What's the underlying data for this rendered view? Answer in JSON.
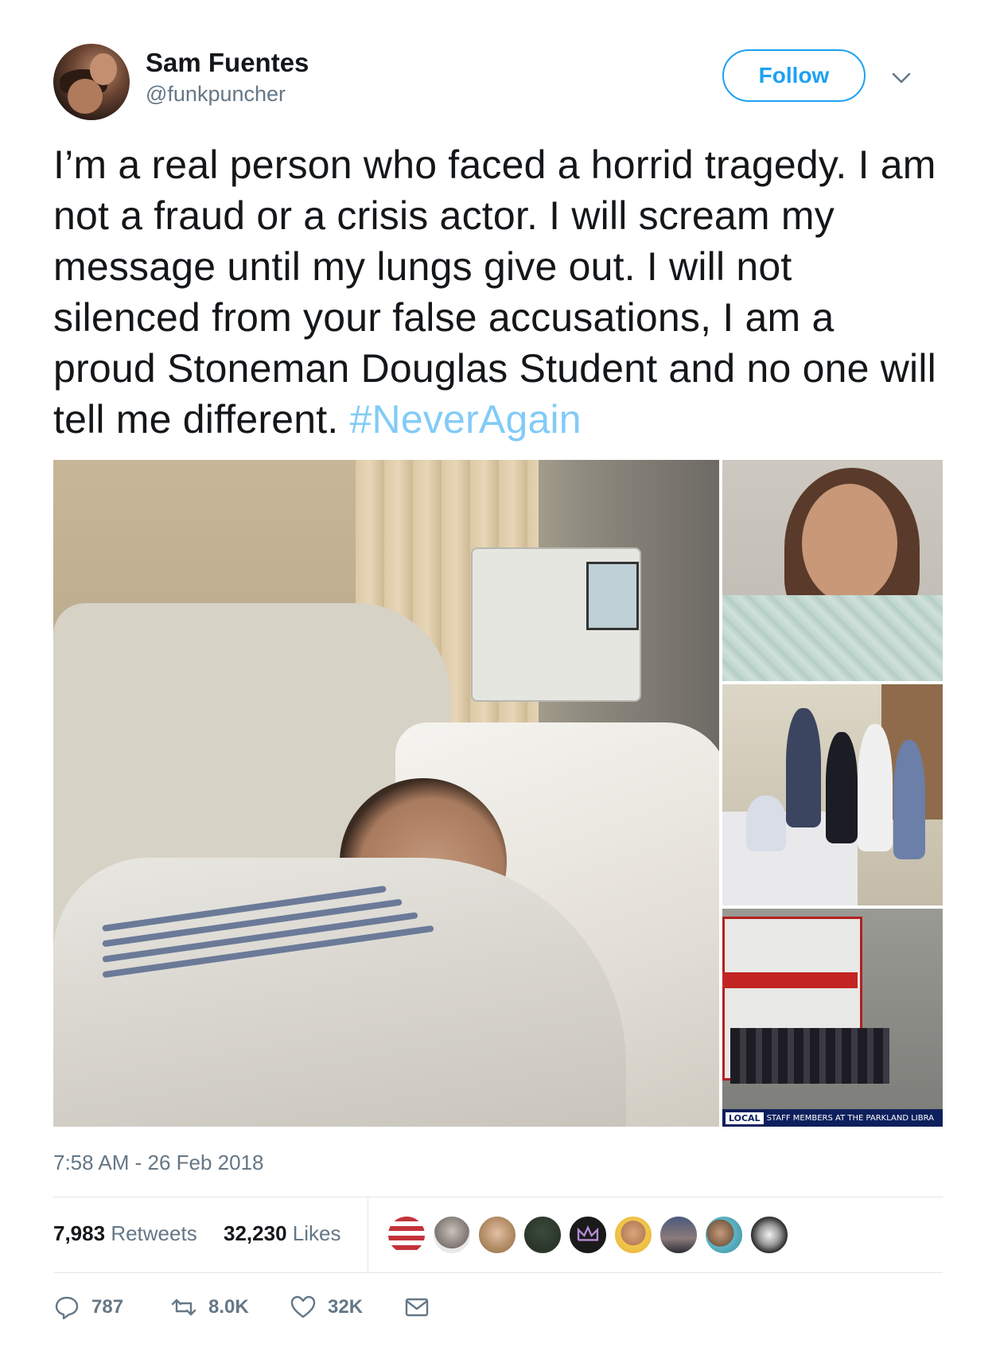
{
  "user": {
    "display_name": "Sam Fuentes",
    "handle": "@funkpuncher",
    "avatar_icon": "profile-photo"
  },
  "follow_label": "Follow",
  "tweet": {
    "text": "I’m a real person who faced a horrid tragedy. I am not a fraud or a crisis actor. I will scream my message until my lungs give out. I will not silenced from your false accusations, I am a proud Stoneman Douglas Student and no one will tell me different.",
    "hashtag": "#NeverAgain"
  },
  "media": {
    "lower_third_tag": "LOCAL",
    "lower_third_text": "STAFF MEMBERS AT THE PARKLAND LIBRA"
  },
  "timestamp": "7:58 AM - 26 Feb 2018",
  "stats": {
    "retweets_count": "7,983",
    "retweets_label": "Retweets",
    "likes_count": "32,230",
    "likes_label": "Likes"
  },
  "actions": {
    "reply_count": "787",
    "retweet_count": "8.0K",
    "like_count": "32K"
  },
  "colors": {
    "accent": "#1da1f2",
    "secondary_text": "#657786",
    "divider": "#e1e8ed"
  }
}
